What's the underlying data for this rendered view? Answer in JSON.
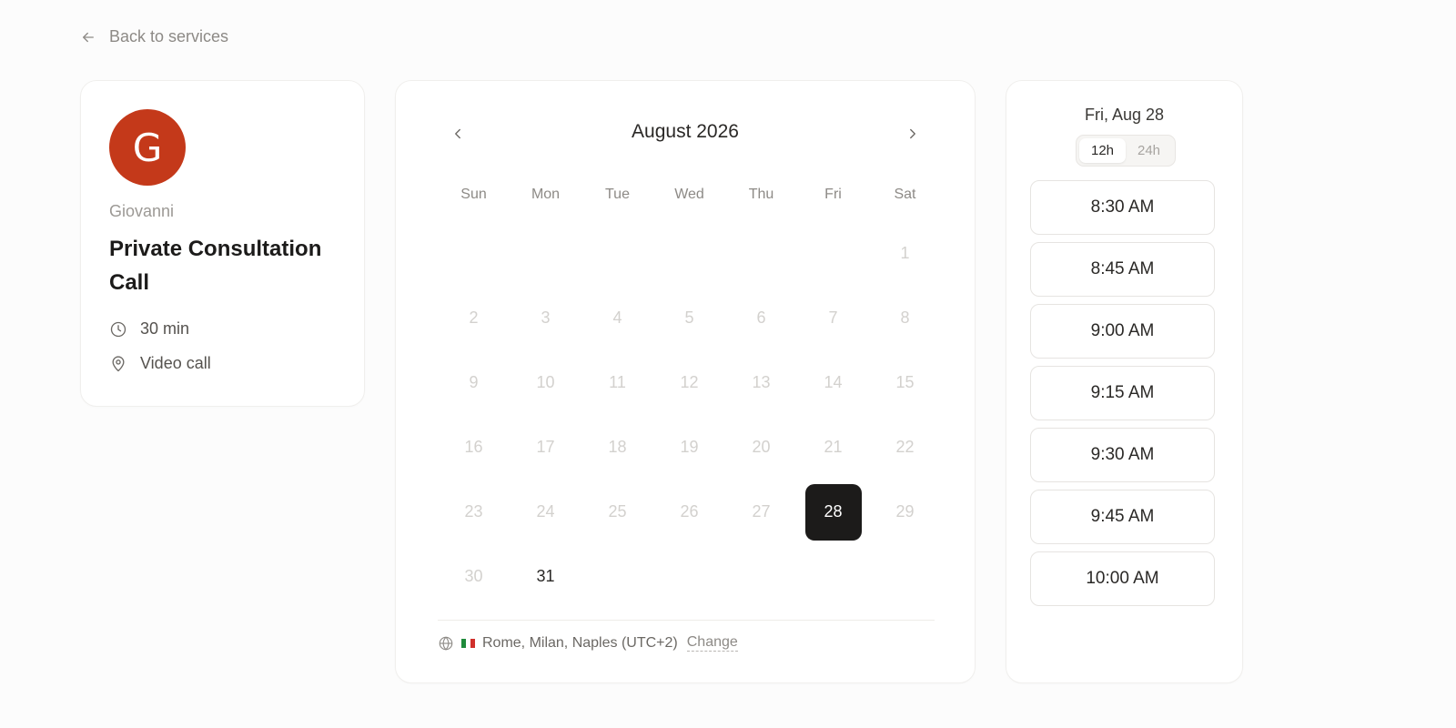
{
  "nav": {
    "back_label": "Back to services",
    "back_icon": "arrow-left-icon"
  },
  "host": {
    "initial": "G",
    "avatar_color": "#c4391a",
    "name": "Giovanni"
  },
  "service": {
    "title": "Private Consultation Call",
    "duration": "30 min",
    "duration_icon": "clock-icon",
    "location": "Video call",
    "location_icon": "map-pin-icon"
  },
  "calendar": {
    "month_label": "August 2026",
    "prev_icon": "chevron-left-icon",
    "next_icon": "chevron-right-icon",
    "weekdays": [
      "Sun",
      "Mon",
      "Tue",
      "Wed",
      "Thu",
      "Fri",
      "Sat"
    ],
    "leading_blanks": 6,
    "days": [
      {
        "label": "1",
        "state": "disabled"
      },
      {
        "label": "2",
        "state": "disabled"
      },
      {
        "label": "3",
        "state": "disabled"
      },
      {
        "label": "4",
        "state": "disabled"
      },
      {
        "label": "5",
        "state": "disabled"
      },
      {
        "label": "6",
        "state": "disabled"
      },
      {
        "label": "7",
        "state": "disabled"
      },
      {
        "label": "8",
        "state": "disabled"
      },
      {
        "label": "9",
        "state": "disabled"
      },
      {
        "label": "10",
        "state": "disabled"
      },
      {
        "label": "11",
        "state": "disabled"
      },
      {
        "label": "12",
        "state": "disabled"
      },
      {
        "label": "13",
        "state": "disabled"
      },
      {
        "label": "14",
        "state": "disabled"
      },
      {
        "label": "15",
        "state": "disabled"
      },
      {
        "label": "16",
        "state": "disabled"
      },
      {
        "label": "17",
        "state": "disabled"
      },
      {
        "label": "18",
        "state": "disabled"
      },
      {
        "label": "19",
        "state": "disabled"
      },
      {
        "label": "20",
        "state": "disabled"
      },
      {
        "label": "21",
        "state": "disabled"
      },
      {
        "label": "22",
        "state": "disabled"
      },
      {
        "label": "23",
        "state": "disabled"
      },
      {
        "label": "24",
        "state": "disabled"
      },
      {
        "label": "25",
        "state": "disabled"
      },
      {
        "label": "26",
        "state": "disabled"
      },
      {
        "label": "27",
        "state": "disabled"
      },
      {
        "label": "28",
        "state": "selected"
      },
      {
        "label": "29",
        "state": "disabled"
      },
      {
        "label": "30",
        "state": "disabled"
      },
      {
        "label": "31",
        "state": "available"
      }
    ],
    "selected_color": "#1c1b1a"
  },
  "timezone": {
    "icon": "globe-icon",
    "flag": "italy-flag",
    "label": "Rome, Milan, Naples (UTC+2)",
    "change_label": "Change"
  },
  "slots": {
    "date_label": "Fri, Aug 28",
    "format_options": [
      "12h",
      "24h"
    ],
    "active_format": "12h",
    "times": [
      "8:30 AM",
      "8:45 AM",
      "9:00 AM",
      "9:15 AM",
      "9:30 AM",
      "9:45 AM",
      "10:00 AM"
    ]
  }
}
